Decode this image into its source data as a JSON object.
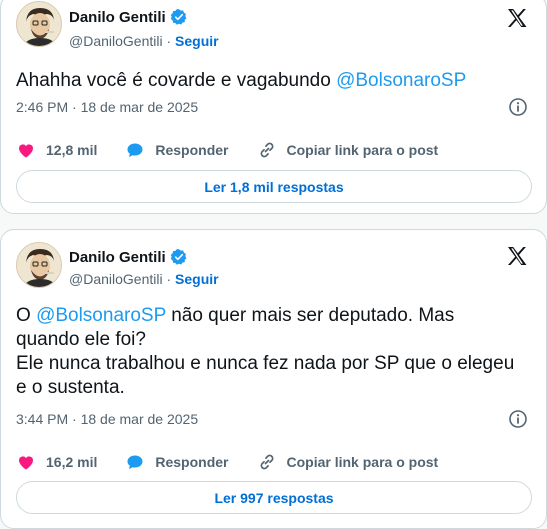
{
  "colors": {
    "link": "#1d9bf0",
    "follow": "#006fd6",
    "heart": "#f91880",
    "muted": "#536471"
  },
  "tweets": [
    {
      "author_name": "Danilo Gentili",
      "handle": "@DaniloGentili",
      "separator": "·",
      "follow_label": "Seguir",
      "text_before": "Ahahha você é covarde e vagabundo ",
      "mention": "@BolsonaroSP",
      "text_after": "",
      "timestamp": "2:46 PM · 18 de mar de 2025",
      "likes": "12,8 mil",
      "reply_label": "Responder",
      "copy_label": "Copiar link para o post",
      "read_replies": "Ler 1,8 mil respostas"
    },
    {
      "author_name": "Danilo Gentili",
      "handle": "@DaniloGentili",
      "separator": "·",
      "follow_label": "Seguir",
      "text_before": "O ",
      "mention": "@BolsonaroSP",
      "text_after": " não quer mais ser deputado. Mas\nquando ele foi?\nEle nunca trabalhou e nunca fez nada por SP que o elegeu\ne o sustenta.",
      "timestamp": "3:44 PM · 18 de mar de 2025",
      "likes": "16,2 mil",
      "reply_label": "Responder",
      "copy_label": "Copiar link para o post",
      "read_replies": "Ler 997 respostas"
    }
  ],
  "icons": [
    "verified-badge-icon",
    "x-logo-icon",
    "info-icon",
    "heart-icon",
    "reply-bubble-icon",
    "link-icon"
  ]
}
